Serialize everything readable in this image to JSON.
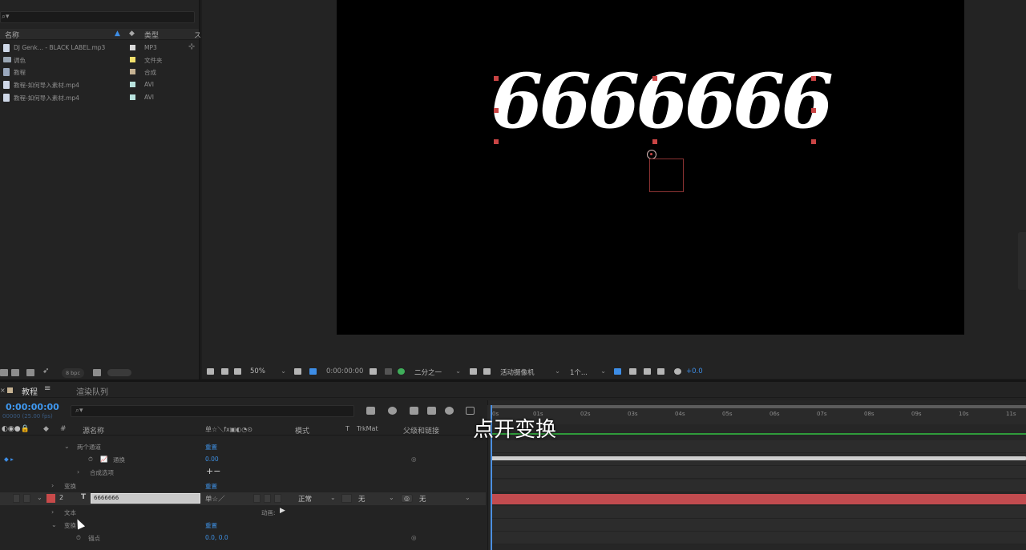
{
  "project": {
    "search_placeholder": "⌕▾",
    "columns": {
      "name": "名称",
      "type": "类型",
      "extra": "ス"
    },
    "items": [
      {
        "name": "DJ Genk... - BLACK LABEL.mp3",
        "type": "MP3",
        "icon": "audio-file-icon",
        "color": "#d9d9d9"
      },
      {
        "name": "调色",
        "type": "文件夹",
        "icon": "folder-icon",
        "color": "#f3e06c"
      },
      {
        "name": "教程",
        "type": "合成",
        "icon": "composition-icon",
        "color": "#c6b292"
      },
      {
        "name": "教程-如何导入素材.mp4",
        "type": "AVI",
        "icon": "video-file-icon",
        "color": "#b9e3de"
      },
      {
        "name": "教程-如何导入素材.mp4",
        "type": "AVI",
        "icon": "video-file-icon",
        "color": "#b9e3de"
      }
    ],
    "bit_depth": "8 bpc"
  },
  "viewer": {
    "text_layer_content": "6666666",
    "toolbar": {
      "zoom": "50%",
      "timecode": "0:00:00:00",
      "resolution": "二分之一",
      "camera": "活动摄像机",
      "views": "1个...",
      "exposure": "+0.0"
    }
  },
  "timeline": {
    "tabs": {
      "comp": "教程",
      "render_queue": "渲染队列",
      "menu": "≡"
    },
    "timecode": "0:00:00:00",
    "fps": "00000 (25.00 fps)",
    "search_placeholder": "⌕▾",
    "columns": {
      "num": "#",
      "source": "源名称",
      "switches": "单☆＼fx▣◐◔⊙",
      "mode": "模式",
      "t": "T",
      "trkmat": "TrkMat",
      "parent": "父级和链接"
    },
    "rows": {
      "effect_group": "两个通道",
      "effect_prop": "通换",
      "effect_prop_value": "0.00",
      "composite_options": "合成选项",
      "composite_value": "+−",
      "reset1": "重置",
      "reset2": "重置",
      "transform1": "变换",
      "reset3": "重置",
      "text": "文本",
      "animate": "动画:",
      "transform2": "变换",
      "reset4": "重置",
      "anchor": "锚点",
      "anchor_value": "0.0, 0.0"
    },
    "layer2": {
      "num": "2",
      "name": "6666666",
      "mode": "正常",
      "trkmat": "无",
      "parent": "无",
      "label_color": "#c84a4a"
    },
    "ruler": [
      "0s",
      "01s",
      "02s",
      "03s",
      "04s",
      "05s",
      "06s",
      "07s",
      "08s",
      "09s",
      "10s",
      "11s"
    ]
  },
  "subtitle": "点开变换"
}
